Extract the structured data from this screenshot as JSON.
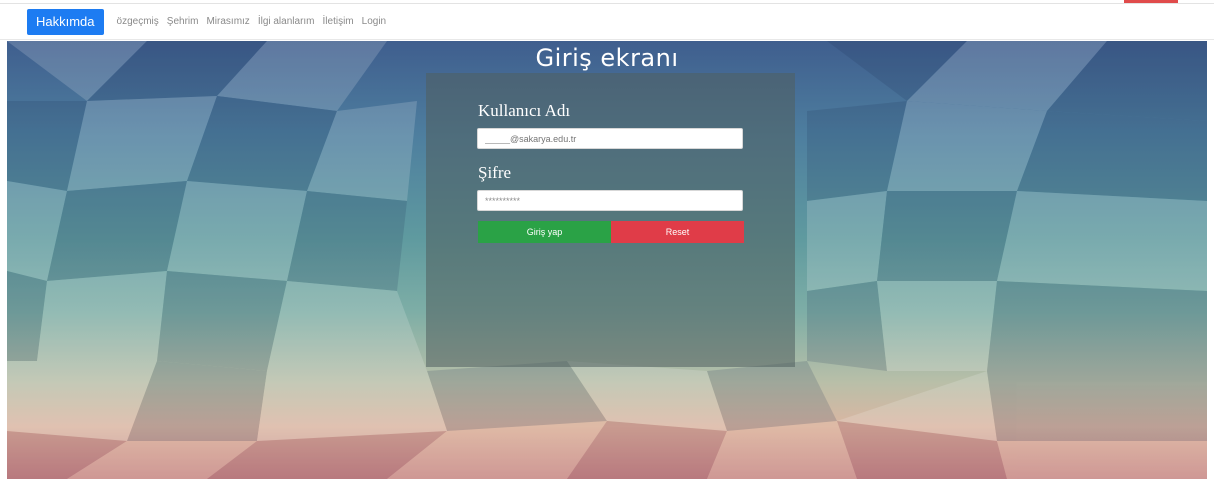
{
  "navbar": {
    "brand": "Hakkımda",
    "links": [
      "özgeçmiş",
      "Şehrim",
      "Mirasımız",
      "İlgi alanlarım",
      "İletişim",
      "Login"
    ]
  },
  "main": {
    "title": "Giriş ekranı",
    "form": {
      "username_label": "Kullanıcı Adı",
      "username_placeholder": "_____@sakarya.edu.tr",
      "password_label": "Şifre",
      "password_value": "**********",
      "login_button": "Giriş yap",
      "reset_button": "Reset"
    }
  },
  "colors": {
    "brand": "#1d7cf2",
    "login_button": "#2aa246",
    "reset_button": "#e03c48"
  }
}
